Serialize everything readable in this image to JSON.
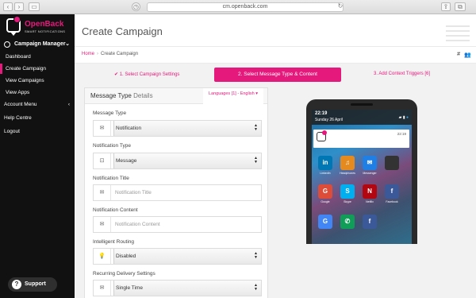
{
  "browser": {
    "url": "cm.openback.com"
  },
  "sidebar": {
    "logo_name": "OpenBack",
    "logo_sub": "SMART NOTIFICATIONS",
    "campaign_manager": "Campaign Manager",
    "sub_items": [
      {
        "label": "Dashboard"
      },
      {
        "label": "Create Campaign"
      },
      {
        "label": "View Campaigns"
      },
      {
        "label": "View Apps"
      }
    ],
    "account_menu": "Account Menu",
    "help_centre": "Help Centre",
    "logout": "Logout",
    "support": "Support"
  },
  "header": {
    "title": "Create Campaign",
    "breadcrumb_home": "Home",
    "breadcrumb_current": "Create Campaign",
    "hash": "#"
  },
  "steps": {
    "step1": "✔ 1. Select Campaign Settings",
    "step2": "2. Select Message Type & Content",
    "step3": "3. Add Context Triggers [6]"
  },
  "panel": {
    "title_strong": "Message Type",
    "title_rest": " Details",
    "languages": "Languages [1] - English ▾",
    "fields": {
      "message_type": {
        "label": "Message Type",
        "value": "Notification"
      },
      "notification_type": {
        "label": "Notification Type",
        "value": "Message"
      },
      "notification_title": {
        "label": "Notification Title",
        "placeholder": "Notification Title"
      },
      "notification_content": {
        "label": "Notification Content",
        "placeholder": "Notification Content"
      },
      "intelligent_routing": {
        "label": "Intelligent Routing",
        "value": "Disabled"
      },
      "recurring_delivery": {
        "label": "Recurring Delivery Settings",
        "value": "Single Time"
      }
    }
  },
  "phone": {
    "time": "22:19",
    "date": "Sunday 26 April",
    "notif_time": "22:19",
    "apps": [
      {
        "label": "LinkedIn",
        "glyph": "in",
        "color": "#0077b5"
      },
      {
        "label": "Headphones",
        "glyph": "♫",
        "color": "#e58a1f"
      },
      {
        "label": "Messenger",
        "glyph": "✉",
        "color": "#1f7fe5"
      },
      {
        "label": "",
        "glyph": "",
        "color": "#333333"
      },
      {
        "label": "Google",
        "glyph": "G",
        "color": "#dd4b39"
      },
      {
        "label": "Skype",
        "glyph": "S",
        "color": "#00aff0"
      },
      {
        "label": "Netflix",
        "glyph": "N",
        "color": "#b20710"
      },
      {
        "label": "Facebook",
        "glyph": "f",
        "color": "#3b5998"
      }
    ]
  },
  "colors": {
    "accent": "#e5197c",
    "sidebar_bg": "#111111",
    "content_bg": "#f2f2f2"
  }
}
